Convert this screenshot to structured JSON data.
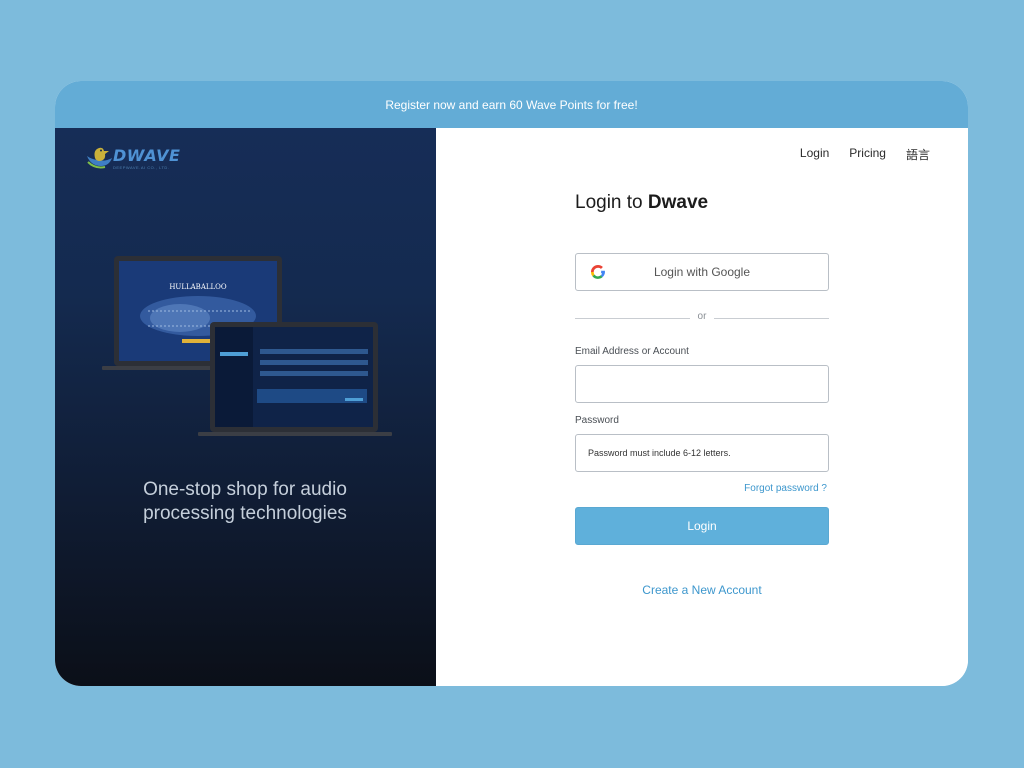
{
  "banner": {
    "text": "Register now and earn 60 Wave Points for free!"
  },
  "brand": {
    "name": "DWAVE",
    "sub": "DEEPWAVE.AI CO., LTD.",
    "color": "#4f92d4"
  },
  "hero": {
    "tagline_line1": "One-stop shop for audio",
    "tagline_line2": "processing technologies",
    "screen_title": "HULLABALLOO"
  },
  "nav": {
    "items": [
      "Login",
      "Pricing",
      "語言"
    ]
  },
  "form": {
    "title_prefix": "Login to ",
    "title_brand": "Dwave",
    "google_label": "Login with Google",
    "divider_text": "or",
    "email_label": "Email Address or Account",
    "email_value": "",
    "password_label": "Password",
    "password_placeholder": "Password must include 6-12 letters.",
    "forgot_label": "Forgot password ?",
    "login_label": "Login",
    "create_label": "Create a New Account"
  },
  "colors": {
    "page_bg": "#7dbbdc",
    "banner_bg": "#63acd6",
    "accent": "#5fb0db",
    "link": "#3d97cd"
  }
}
